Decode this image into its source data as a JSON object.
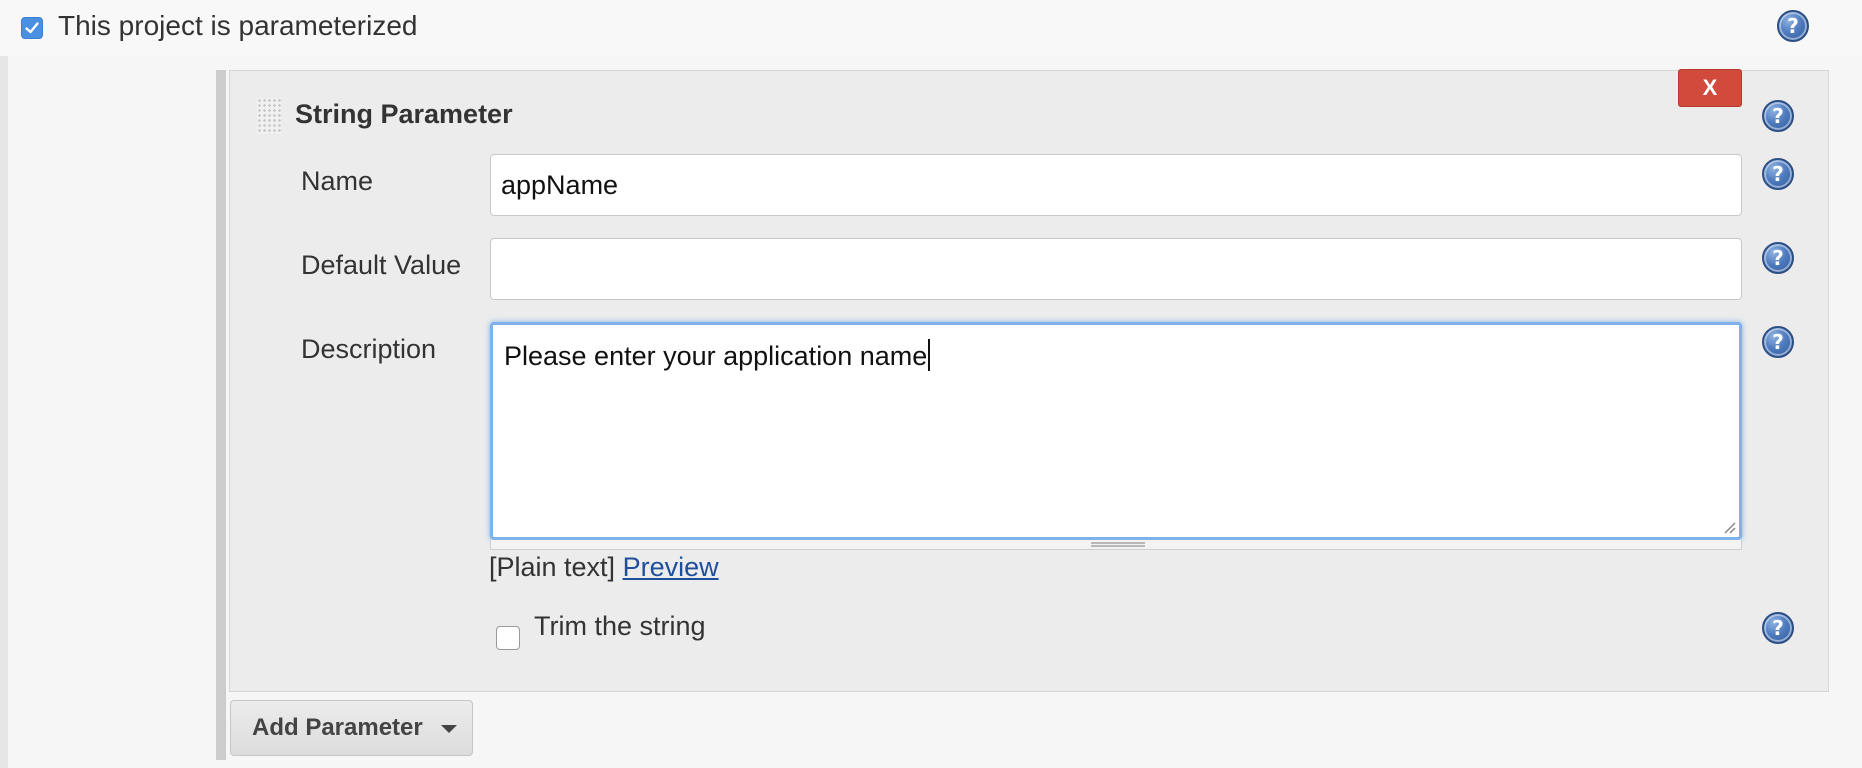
{
  "header": {
    "parameterized_label": "This project is parameterized",
    "parameterized_checked": true
  },
  "parameter": {
    "type_title": "String Parameter",
    "delete_label": "X",
    "fields": {
      "name": {
        "label": "Name",
        "value": "appName"
      },
      "default_value": {
        "label": "Default Value",
        "value": ""
      },
      "description": {
        "label": "Description",
        "value": "Please enter your application name"
      }
    },
    "markup_format": "[Plain text]",
    "preview_link": "Preview",
    "trim": {
      "label": "Trim the string",
      "checked": false
    }
  },
  "help_icon_glyph": "?",
  "add_parameter_label": "Add Parameter",
  "colors": {
    "delete_button": "#d24a3c",
    "checkbox_accent": "#4a90e2",
    "link": "#1f4f9c",
    "focus_ring": "#7fb2ea"
  },
  "icons": [
    "checkbox-checked-icon",
    "help-icon",
    "drag-handle-icon",
    "resize-grip-icon",
    "caret-down-icon"
  ]
}
